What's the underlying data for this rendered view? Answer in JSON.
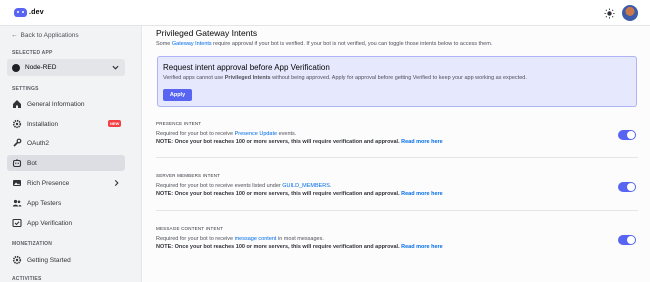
{
  "header": {
    "logo_text": ".dev",
    "theme_icon": "sun-icon",
    "avatar": "user-avatar"
  },
  "sidebar": {
    "back_label": "Back to Applications",
    "selected_app_heading": "SELECTED APP",
    "selected_app": "Node-RED",
    "settings_heading": "SETTINGS",
    "items": [
      {
        "label": "General Information",
        "icon": "home-icon"
      },
      {
        "label": "Installation",
        "icon": "gear-icon",
        "badge": "NEW"
      },
      {
        "label": "OAuth2",
        "icon": "wrench-icon"
      },
      {
        "label": "Bot",
        "icon": "bot-icon",
        "active": true
      },
      {
        "label": "Rich Presence",
        "icon": "image-icon"
      },
      {
        "label": "App Testers",
        "icon": "users-icon"
      },
      {
        "label": "App Verification",
        "icon": "verified-icon"
      }
    ],
    "monetization_heading": "MONETIZATION",
    "monetization_items": [
      {
        "label": "Getting Started",
        "icon": "gear-icon"
      }
    ],
    "activities_heading": "ACTIVITIES"
  },
  "main": {
    "title": "Privileged Gateway Intents",
    "subtitle_before": "Some ",
    "subtitle_link": "Gateway Intents",
    "subtitle_after": " require approval if your bot is verified. If your bot is not verified, you can toggle those intents below to access them.",
    "notice": {
      "title": "Request intent approval before App Verification",
      "body_before": "Verified apps cannot use ",
      "body_bold": "Privileged Intents",
      "body_after": " without being approved. Apply for approval before getting Verified to keep your app working as expected.",
      "button": "Apply"
    },
    "intents": [
      {
        "title": "PRESENCE INTENT",
        "desc_before": "Required for your bot to receive ",
        "desc_link": "Presence Update",
        "desc_after": " events.",
        "note": "NOTE: Once your bot reaches 100 or more servers, this will require verification and approval.",
        "read_more": "Read more here",
        "enabled": true
      },
      {
        "title": "SERVER MEMBERS INTENT",
        "desc_before": "Required for your bot to receive events listed under ",
        "desc_link": "GUILD_MEMBERS",
        "desc_after": ".",
        "note": "NOTE: Once your bot reaches 100 or more servers, this will require verification and approval.",
        "read_more": "Read more here",
        "enabled": true
      },
      {
        "title": "MESSAGE CONTENT INTENT",
        "desc_before": "Required for your bot to receive ",
        "desc_link": "message content",
        "desc_after": " in most messages.",
        "note": "NOTE: Once your bot reaches 100 or more servers, this will require verification and approval.",
        "read_more": "Read more here",
        "enabled": true
      }
    ]
  },
  "colors": {
    "accent": "#5865f2",
    "link": "#006ce7",
    "badge": "#f23f43"
  }
}
